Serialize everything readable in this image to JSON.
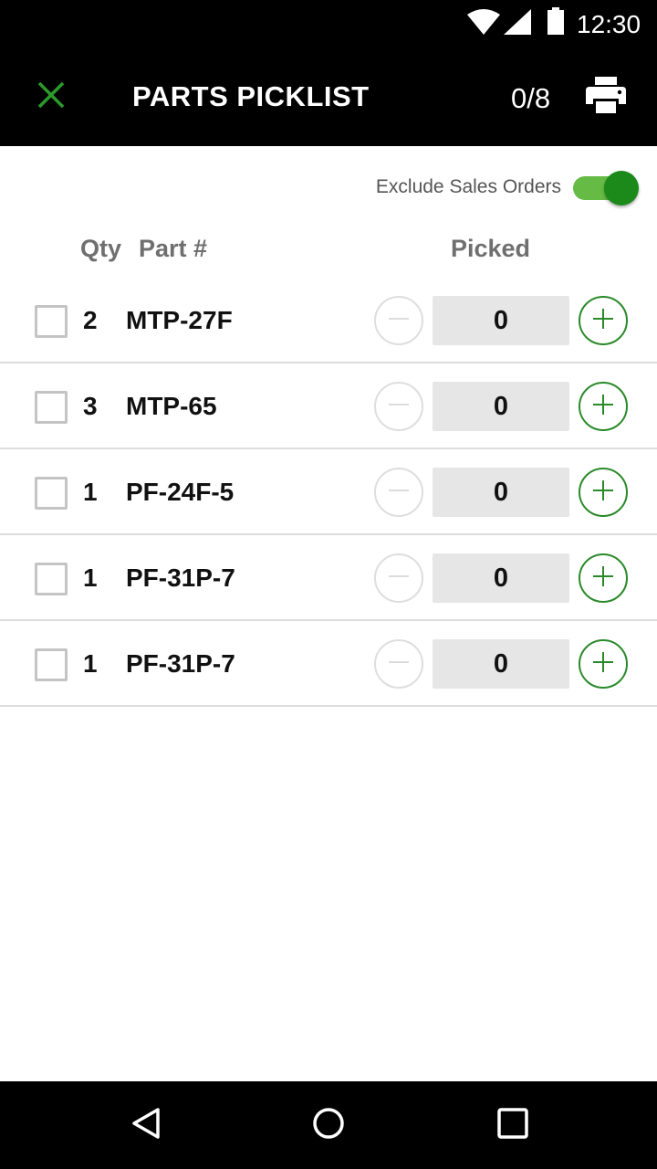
{
  "status_bar": {
    "time": "12:30",
    "icons": [
      "wifi-icon",
      "signal-icon",
      "battery-icon"
    ]
  },
  "app_bar": {
    "title": "PARTS PICKLIST",
    "count": "0/8",
    "close_icon": "close-icon",
    "print_icon": "print-icon"
  },
  "filter": {
    "exclude_label": "Exclude Sales Orders",
    "exclude_on": true
  },
  "columns": {
    "qty": "Qty",
    "part": "Part #",
    "picked": "Picked"
  },
  "rows": [
    {
      "qty": "2",
      "part": "MTP-27F",
      "picked": "0",
      "checked": false
    },
    {
      "qty": "3",
      "part": "MTP-65",
      "picked": "0",
      "checked": false
    },
    {
      "qty": "1",
      "part": "PF-24F-5",
      "picked": "0",
      "checked": false
    },
    {
      "qty": "1",
      "part": "PF-31P-7",
      "picked": "0",
      "checked": false
    },
    {
      "qty": "1",
      "part": "PF-31P-7",
      "picked": "0",
      "checked": false
    }
  ],
  "nav_bar": {
    "icons": [
      "back-icon",
      "home-icon",
      "recent-apps-icon"
    ]
  },
  "colors": {
    "accent": "#1b8a1b",
    "accent_light": "#66bb44",
    "bar_background": "#000000",
    "stepper_field": "#e6e6e6"
  }
}
